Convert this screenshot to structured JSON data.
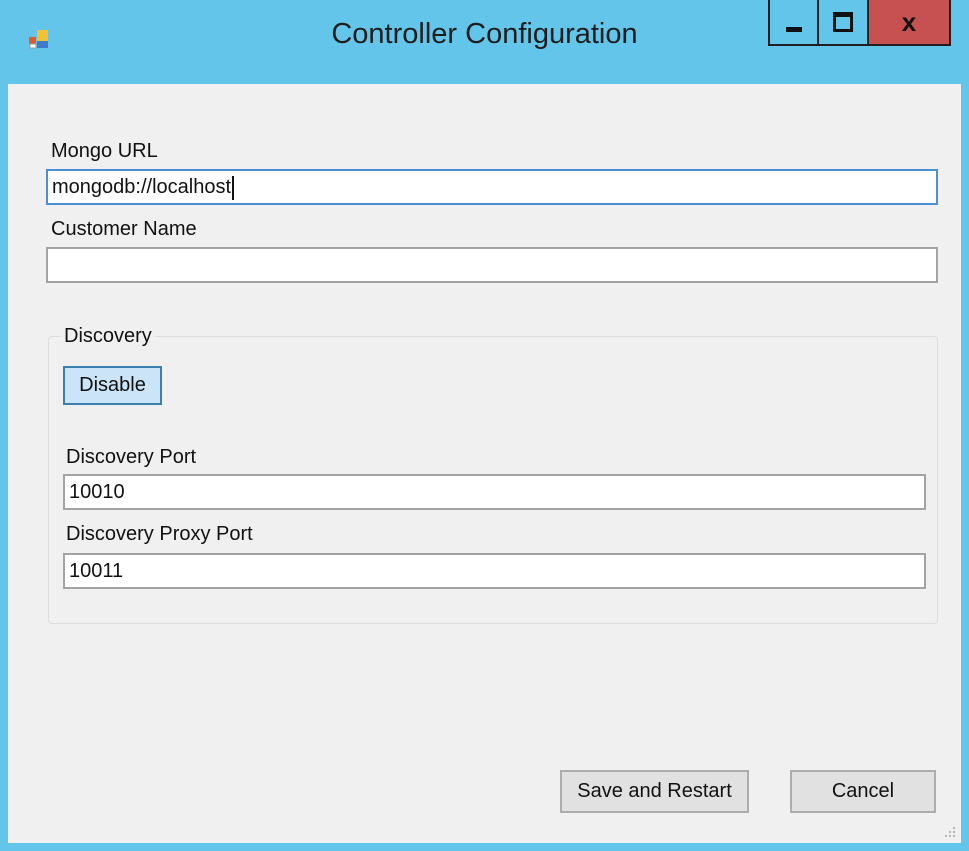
{
  "window": {
    "title": "Controller Configuration",
    "app_icon": "app-icon",
    "controls": {
      "minimize_icon": "minimize-icon",
      "maximize_icon": "maximize-icon",
      "close_glyph": "x"
    }
  },
  "form": {
    "mongo_url": {
      "label": "Mongo URL",
      "value": "mongodb://localhost"
    },
    "customer_name": {
      "label": "Customer Name",
      "value": ""
    },
    "discovery": {
      "group_title": "Discovery",
      "toggle_button": "Disable",
      "port": {
        "label": "Discovery Port",
        "value": "10010"
      },
      "proxy_port": {
        "label": "Discovery Proxy Port",
        "value": "10011"
      }
    }
  },
  "actions": {
    "save_label": "Save and Restart",
    "cancel_label": "Cancel"
  },
  "colors": {
    "title_bar": "#62c5e9",
    "close_button": "#c75050",
    "client_bg": "#f0f0f0",
    "focus_border": "#4a8fd6",
    "disable_button_bg": "#cce4f7"
  }
}
